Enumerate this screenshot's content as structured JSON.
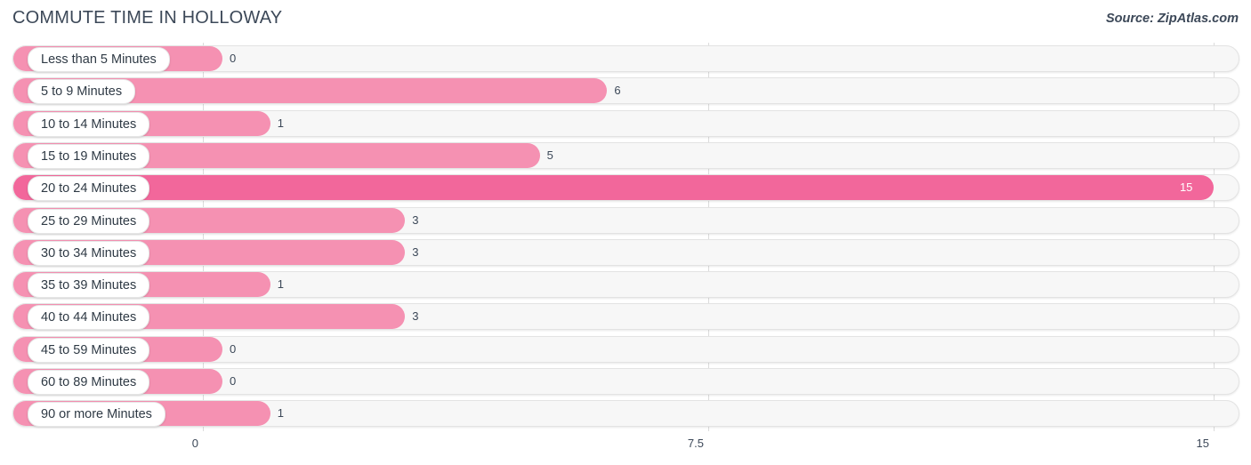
{
  "header": {
    "title": "COMMUTE TIME IN HOLLOWAY",
    "source": "Source: ZipAtlas.com"
  },
  "colors": {
    "bar": "#f591b2",
    "bar_highlight": "#f2679b",
    "track": "#f7f7f7",
    "text": "#3c4858"
  },
  "chart_data": {
    "type": "bar",
    "orientation": "horizontal",
    "title": "COMMUTE TIME IN HOLLOWAY",
    "xlabel": "",
    "ylabel": "",
    "xlim": [
      0,
      15
    ],
    "grid": true,
    "legend": null,
    "xticks": [
      "0",
      "7.5",
      "15"
    ],
    "xtick_values": [
      0,
      7.5,
      15
    ],
    "categories": [
      "Less than 5 Minutes",
      "5 to 9 Minutes",
      "10 to 14 Minutes",
      "15 to 19 Minutes",
      "20 to 24 Minutes",
      "25 to 29 Minutes",
      "30 to 34 Minutes",
      "35 to 39 Minutes",
      "40 to 44 Minutes",
      "45 to 59 Minutes",
      "60 to 89 Minutes",
      "90 or more Minutes"
    ],
    "values": [
      0,
      6,
      1,
      5,
      15,
      3,
      3,
      1,
      3,
      0,
      0,
      1
    ],
    "value_labels": [
      "0",
      "6",
      "1",
      "5",
      "15",
      "3",
      "3",
      "1",
      "3",
      "0",
      "0",
      "1"
    ],
    "highlight_index": 4
  },
  "rows": [
    {
      "label": "Less than 5 Minutes",
      "value": 0,
      "value_label": "0"
    },
    {
      "label": "5 to 9 Minutes",
      "value": 6,
      "value_label": "6"
    },
    {
      "label": "10 to 14 Minutes",
      "value": 1,
      "value_label": "1"
    },
    {
      "label": "15 to 19 Minutes",
      "value": 5,
      "value_label": "5"
    },
    {
      "label": "20 to 24 Minutes",
      "value": 15,
      "value_label": "15"
    },
    {
      "label": "25 to 29 Minutes",
      "value": 3,
      "value_label": "3"
    },
    {
      "label": "30 to 34 Minutes",
      "value": 3,
      "value_label": "3"
    },
    {
      "label": "35 to 39 Minutes",
      "value": 1,
      "value_label": "1"
    },
    {
      "label": "40 to 44 Minutes",
      "value": 3,
      "value_label": "3"
    },
    {
      "label": "45 to 59 Minutes",
      "value": 0,
      "value_label": "0"
    },
    {
      "label": "60 to 89 Minutes",
      "value": 0,
      "value_label": "0"
    },
    {
      "label": "90 or more Minutes",
      "value": 1,
      "value_label": "1"
    }
  ]
}
